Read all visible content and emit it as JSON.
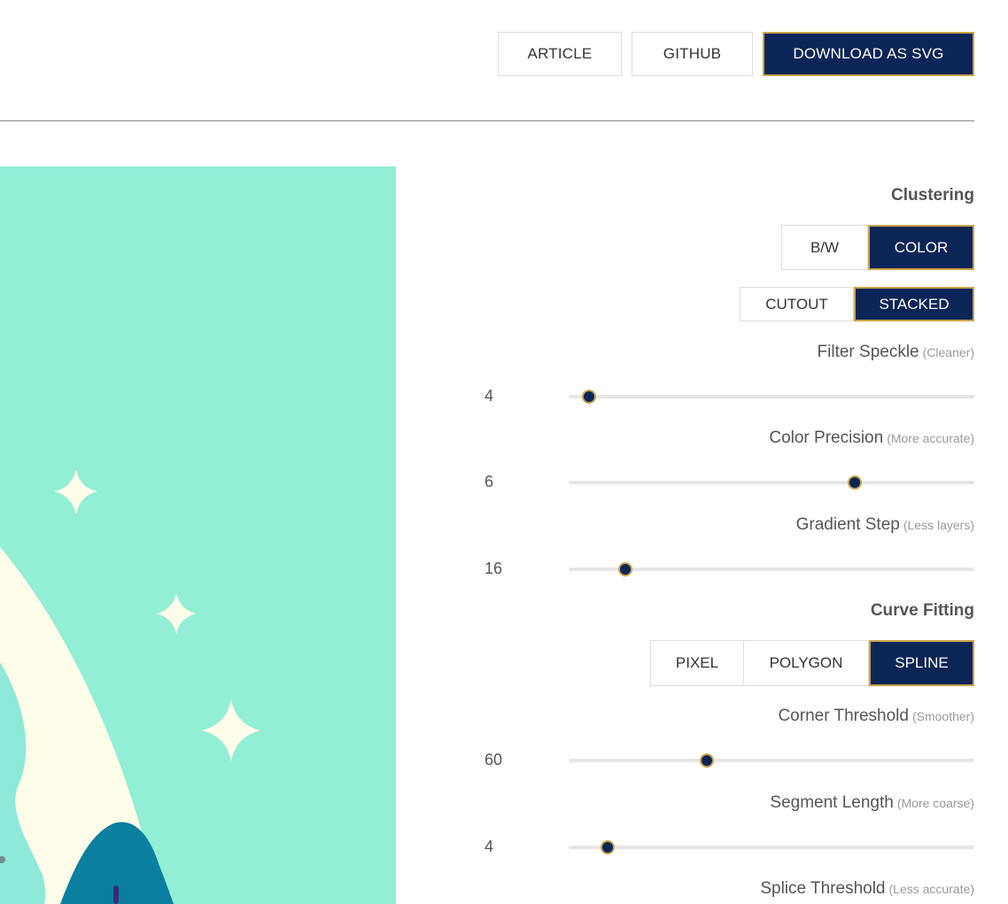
{
  "header": {
    "article_label": "ARTICLE",
    "github_label": "GITHUB",
    "download_label": "DOWNLOAD AS SVG"
  },
  "colors": {
    "primary": "#0c2557",
    "accent_border": "#c9a24a",
    "canvas_bg": "#93eed6",
    "cream": "#fdfde9",
    "teal_dark": "#0a7fa0"
  },
  "clustering": {
    "title": "Clustering",
    "mode": {
      "options": [
        "B/W",
        "COLOR"
      ],
      "selected": "COLOR"
    },
    "layering": {
      "options": [
        "CUTOUT",
        "STACKED"
      ],
      "selected": "STACKED"
    },
    "params": [
      {
        "label": "Filter Speckle",
        "hint": "(Cleaner)",
        "value": "4",
        "fraction": 0.05
      },
      {
        "label": "Color Precision",
        "hint": "(More accurate)",
        "value": "6",
        "fraction": 0.705
      },
      {
        "label": "Gradient Step",
        "hint": "(Less layers)",
        "value": "16",
        "fraction": 0.14
      }
    ]
  },
  "curve_fitting": {
    "title": "Curve Fitting",
    "mode": {
      "options": [
        "PIXEL",
        "POLYGON",
        "SPLINE"
      ],
      "selected": "SPLINE"
    },
    "params": [
      {
        "label": "Corner Threshold",
        "hint": "(Smoother)",
        "value": "60",
        "fraction": 0.34
      },
      {
        "label": "Segment Length",
        "hint": "(More coarse)",
        "value": "4",
        "fraction": 0.095
      },
      {
        "label": "Splice Threshold",
        "hint": "(Less accurate)",
        "value": ""
      }
    ]
  }
}
